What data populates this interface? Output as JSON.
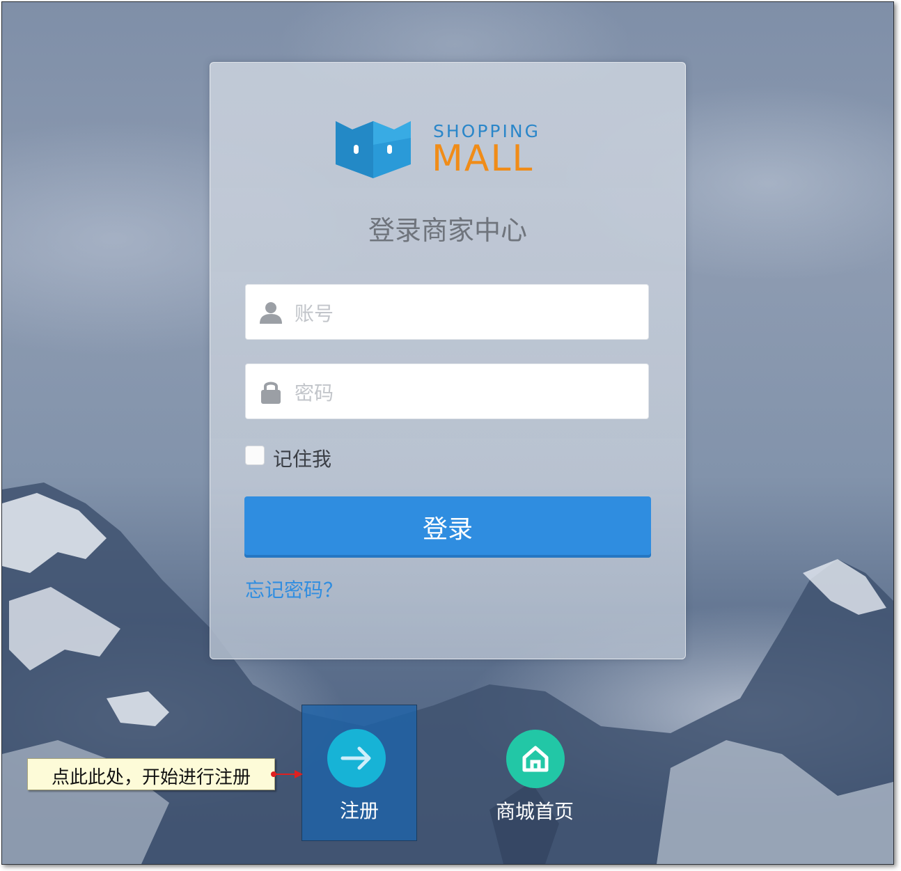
{
  "brand": {
    "logo_top": "SHOPPING",
    "logo_main": "MALL",
    "colors": {
      "logo_blue": "#2a86c9",
      "logo_orange": "#f08c18",
      "primary": "#2f8de0"
    }
  },
  "login": {
    "title": "登录商家中心",
    "account_placeholder": "账号",
    "account_value": "",
    "password_placeholder": "密码",
    "password_value": "",
    "remember_label": "记住我",
    "remember_checked": false,
    "submit_label": "登录",
    "forgot_label": "忘记密码？"
  },
  "footer": {
    "register_label": "注册",
    "register_icon": "arrow-right-icon",
    "home_label": "商城首页",
    "home_icon": "home-icon"
  },
  "annotation": {
    "text": "点此此处，开始进行注册"
  }
}
